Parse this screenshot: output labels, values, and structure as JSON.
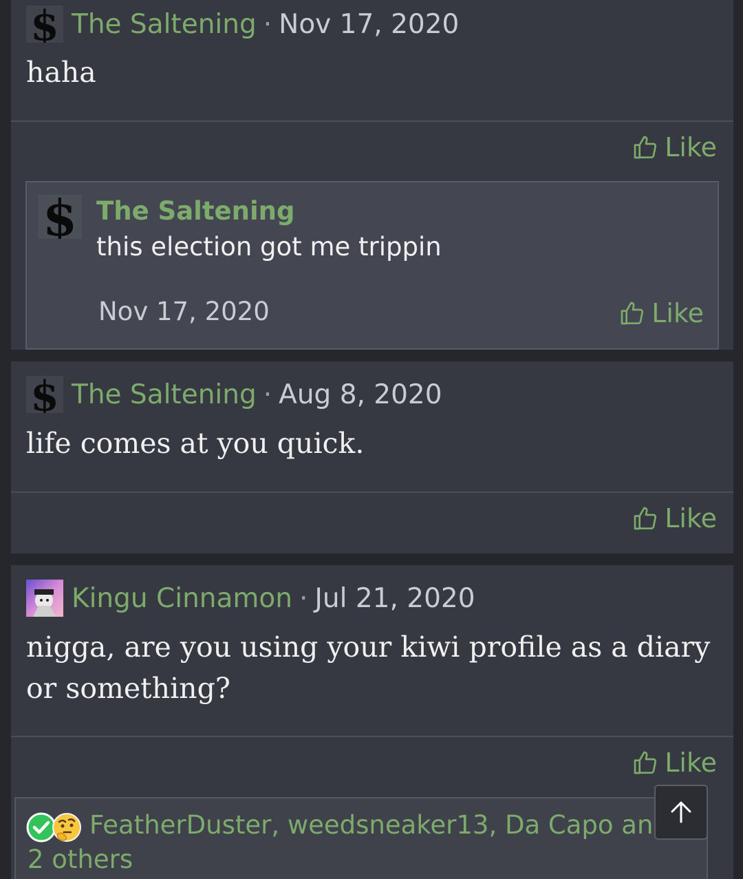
{
  "posts": [
    {
      "author": "The Saltening",
      "separator": "·",
      "date": "Nov 17, 2020",
      "message": "haha",
      "like_label": "Like",
      "reply": {
        "author": "The Saltening",
        "message": "this election got me trippin",
        "date": "Nov 17, 2020",
        "like_label": "Like"
      }
    },
    {
      "author": "The Saltening",
      "separator": "·",
      "date": "Aug 8, 2020",
      "message": "life comes at you quick.",
      "like_label": "Like"
    },
    {
      "author": "Kingu Cinnamon",
      "separator": "·",
      "date": "Jul 21, 2020",
      "message": "nigga, are you using your kiwi profile as a diary or something?",
      "like_label": "Like",
      "reactions": {
        "icons": [
          "check-reaction-icon",
          "thinking-face-reaction-icon"
        ],
        "text": "FeatherDuster, weedsneaker13, Da Capo and 2 others"
      }
    }
  ],
  "colors": {
    "background": "#26272c",
    "card": "#363941",
    "accent_green": "#7dab6b",
    "text": "#f0f0f0",
    "muted": "#c9ccd1"
  },
  "icons": {
    "like": "thumbs-up-icon",
    "scroll_top": "arrow-up-icon",
    "avatar_saltening": "dollar-sign-avatar",
    "avatar_kingu": "anime-character-avatar"
  }
}
